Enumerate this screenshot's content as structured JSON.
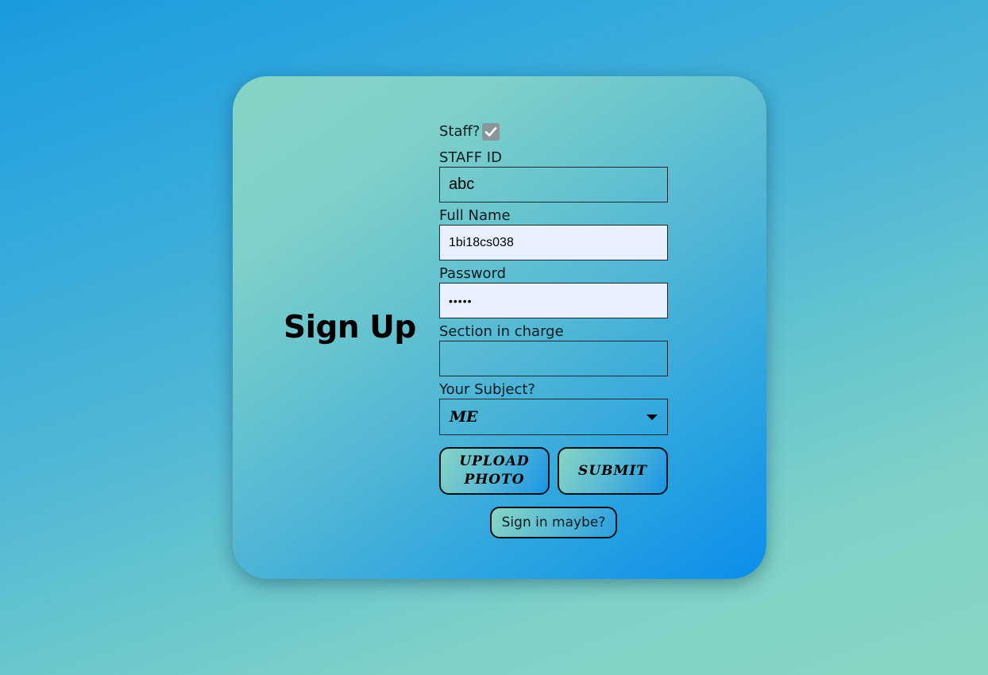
{
  "heading": "Sign Up",
  "staff": {
    "label": "Staff?",
    "checked": true
  },
  "staff_id": {
    "label": "STAFF ID",
    "value": "abc"
  },
  "full_name": {
    "label": "Full Name",
    "value": "1bi18cs038"
  },
  "password": {
    "label": "Password",
    "value": "•••••"
  },
  "section": {
    "label": "Section in charge",
    "value": ""
  },
  "subject": {
    "label": "Your Subject?",
    "selected": "ME"
  },
  "buttons": {
    "upload": "UPLOAD PHOTO",
    "submit": "SUBMIT",
    "signin": "Sign in maybe?"
  },
  "icons": {
    "checkbox": "checkmark-icon",
    "dropdown": "caret-down-icon"
  },
  "colors": {
    "autofill_bg": "#e8f0fe",
    "checkbox_bg": "#8a9699"
  }
}
